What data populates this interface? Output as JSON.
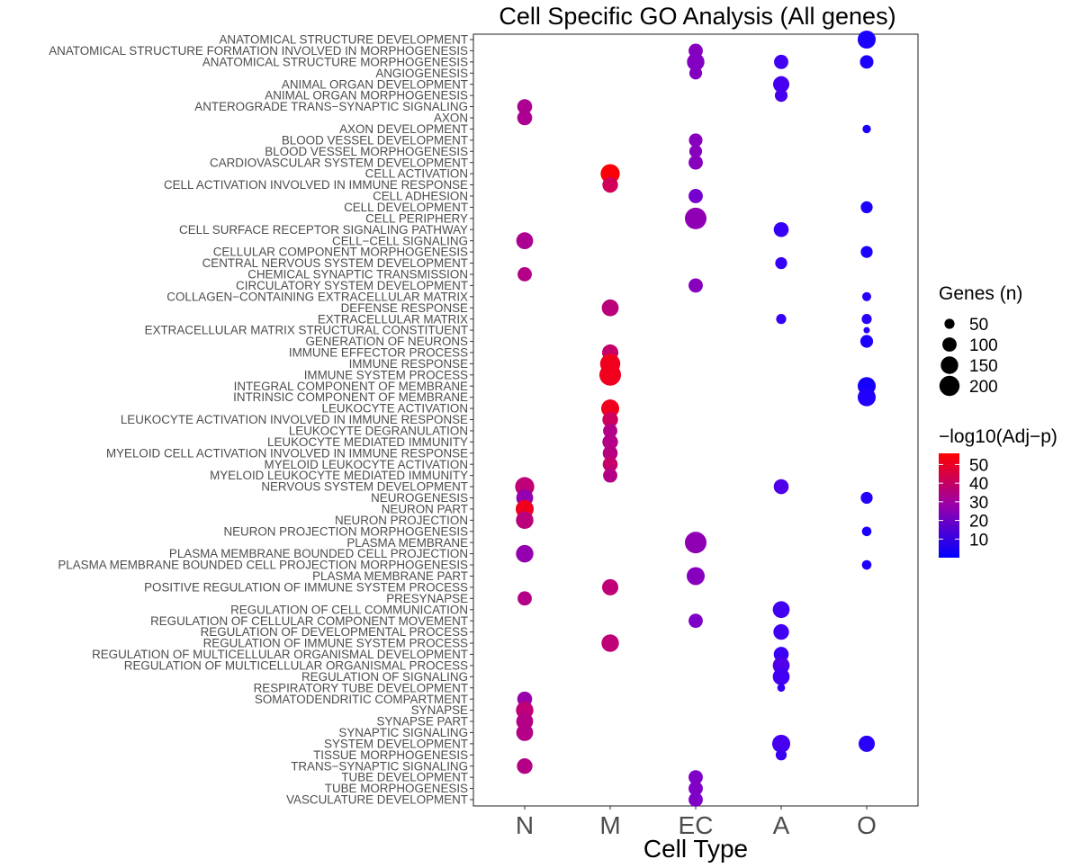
{
  "chart_data": {
    "type": "scatter",
    "subtype": "dot-plot",
    "title": "Cell Specific GO Analysis (All genes)",
    "xlabel": "Cell Type",
    "ylabel": "",
    "x_categories": [
      "N",
      "M",
      "EC",
      "A",
      "O"
    ],
    "y_categories": [
      "ANATOMICAL STRUCTURE DEVELOPMENT",
      "ANATOMICAL STRUCTURE FORMATION INVOLVED IN MORPHOGENESIS",
      "ANATOMICAL STRUCTURE MORPHOGENESIS",
      "ANGIOGENESIS",
      "ANIMAL ORGAN DEVELOPMENT",
      "ANIMAL ORGAN MORPHOGENESIS",
      "ANTEROGRADE TRANS−SYNAPTIC SIGNALING",
      "AXON",
      "AXON DEVELOPMENT",
      "BLOOD VESSEL DEVELOPMENT",
      "BLOOD VESSEL MORPHOGENESIS",
      "CARDIOVASCULAR SYSTEM DEVELOPMENT",
      "CELL ACTIVATION",
      "CELL ACTIVATION INVOLVED IN IMMUNE RESPONSE",
      "CELL ADHESION",
      "CELL DEVELOPMENT",
      "CELL PERIPHERY",
      "CELL SURFACE RECEPTOR SIGNALING PATHWAY",
      "CELL−CELL SIGNALING",
      "CELLULAR COMPONENT MORPHOGENESIS",
      "CENTRAL NERVOUS SYSTEM DEVELOPMENT",
      "CHEMICAL SYNAPTIC TRANSMISSION",
      "CIRCULATORY SYSTEM DEVELOPMENT",
      "COLLAGEN−CONTAINING EXTRACELLULAR MATRIX",
      "DEFENSE RESPONSE",
      "EXTRACELLULAR MATRIX",
      "EXTRACELLULAR MATRIX STRUCTURAL CONSTITUENT",
      "GENERATION OF NEURONS",
      "IMMUNE EFFECTOR PROCESS",
      "IMMUNE RESPONSE",
      "IMMUNE SYSTEM PROCESS",
      "INTEGRAL COMPONENT OF MEMBRANE",
      "INTRINSIC COMPONENT OF MEMBRANE",
      "LEUKOCYTE ACTIVATION",
      "LEUKOCYTE ACTIVATION INVOLVED IN IMMUNE RESPONSE",
      "LEUKOCYTE DEGRANULATION",
      "LEUKOCYTE MEDIATED IMMUNITY",
      "MYELOID CELL ACTIVATION INVOLVED IN IMMUNE RESPONSE",
      "MYELOID LEUKOCYTE ACTIVATION",
      "MYELOID LEUKOCYTE MEDIATED IMMUNITY",
      "NERVOUS SYSTEM DEVELOPMENT",
      "NEUROGENESIS",
      "NEURON PART",
      "NEURON PROJECTION",
      "NEURON PROJECTION MORPHOGENESIS",
      "PLASMA MEMBRANE",
      "PLASMA MEMBRANE BOUNDED CELL PROJECTION",
      "PLASMA MEMBRANE BOUNDED CELL PROJECTION MORPHOGENESIS",
      "PLASMA MEMBRANE PART",
      "POSITIVE REGULATION OF IMMUNE SYSTEM PROCESS",
      "PRESYNAPSE",
      "REGULATION OF CELL COMMUNICATION",
      "REGULATION OF CELLULAR COMPONENT MOVEMENT",
      "REGULATION OF DEVELOPMENTAL PROCESS",
      "REGULATION OF IMMUNE SYSTEM PROCESS",
      "REGULATION OF MULTICELLULAR ORGANISMAL DEVELOPMENT",
      "REGULATION OF MULTICELLULAR ORGANISMAL PROCESS",
      "REGULATION OF SIGNALING",
      "RESPIRATORY TUBE DEVELOPMENT",
      "SOMATODENDRITIC COMPARTMENT",
      "SYNAPSE",
      "SYNAPSE PART",
      "SYNAPTIC SIGNALING",
      "SYSTEM DEVELOPMENT",
      "TISSUE MORPHOGENESIS",
      "TRANS−SYNAPTIC SIGNALING",
      "TUBE DEVELOPMENT",
      "TUBE MORPHOGENESIS",
      "VASCULATURE DEVELOPMENT"
    ],
    "points": [
      {
        "term": "ANATOMICAL STRUCTURE DEVELOPMENT",
        "cell": "O",
        "genes": 160,
        "neglog10p": 3
      },
      {
        "term": "ANATOMICAL STRUCTURE FORMATION INVOLVED IN MORPHOGENESIS",
        "cell": "EC",
        "genes": 100,
        "neglog10p": 24
      },
      {
        "term": "ANATOMICAL STRUCTURE MORPHOGENESIS",
        "cell": "EC",
        "genes": 150,
        "neglog10p": 23
      },
      {
        "term": "ANATOMICAL STRUCTURE MORPHOGENESIS",
        "cell": "A",
        "genes": 100,
        "neglog10p": 9
      },
      {
        "term": "ANATOMICAL STRUCTURE MORPHOGENESIS",
        "cell": "O",
        "genes": 90,
        "neglog10p": 3
      },
      {
        "term": "ANGIOGENESIS",
        "cell": "EC",
        "genes": 80,
        "neglog10p": 23
      },
      {
        "term": "ANIMAL ORGAN DEVELOPMENT",
        "cell": "A",
        "genes": 130,
        "neglog10p": 10
      },
      {
        "term": "ANIMAL ORGAN MORPHOGENESIS",
        "cell": "A",
        "genes": 80,
        "neglog10p": 10
      },
      {
        "term": "ANTEROGRADE TRANS−SYNAPTIC SIGNALING",
        "cell": "N",
        "genes": 110,
        "neglog10p": 33
      },
      {
        "term": "AXON",
        "cell": "N",
        "genes": 110,
        "neglog10p": 33
      },
      {
        "term": "AXON DEVELOPMENT",
        "cell": "O",
        "genes": 35,
        "neglog10p": 3
      },
      {
        "term": "BLOOD VESSEL DEVELOPMENT",
        "cell": "EC",
        "genes": 90,
        "neglog10p": 24
      },
      {
        "term": "BLOOD VESSEL MORPHOGENESIS",
        "cell": "EC",
        "genes": 80,
        "neglog10p": 24
      },
      {
        "term": "CARDIOVASCULAR SYSTEM DEVELOPMENT",
        "cell": "EC",
        "genes": 100,
        "neglog10p": 24
      },
      {
        "term": "CELL ACTIVATION",
        "cell": "M",
        "genes": 180,
        "neglog10p": 55
      },
      {
        "term": "CELL ACTIVATION INVOLVED IN IMMUNE RESPONSE",
        "cell": "M",
        "genes": 120,
        "neglog10p": 43
      },
      {
        "term": "CELL ADHESION",
        "cell": "EC",
        "genes": 100,
        "neglog10p": 20
      },
      {
        "term": "CELL DEVELOPMENT",
        "cell": "O",
        "genes": 70,
        "neglog10p": 3
      },
      {
        "term": "CELL PERIPHERY",
        "cell": "EC",
        "genes": 230,
        "neglog10p": 26
      },
      {
        "term": "CELL SURFACE RECEPTOR SIGNALING PATHWAY",
        "cell": "A",
        "genes": 110,
        "neglog10p": 7
      },
      {
        "term": "CELL−CELL SIGNALING",
        "cell": "N",
        "genes": 140,
        "neglog10p": 33
      },
      {
        "term": "CELLULAR COMPONENT MORPHOGENESIS",
        "cell": "O",
        "genes": 70,
        "neglog10p": 3
      },
      {
        "term": "CENTRAL NERVOUS SYSTEM DEVELOPMENT",
        "cell": "A",
        "genes": 70,
        "neglog10p": 7
      },
      {
        "term": "CHEMICAL SYNAPTIC TRANSMISSION",
        "cell": "N",
        "genes": 100,
        "neglog10p": 35
      },
      {
        "term": "CIRCULATORY SYSTEM DEVELOPMENT",
        "cell": "EC",
        "genes": 100,
        "neglog10p": 24
      },
      {
        "term": "COLLAGEN−CONTAINING EXTRACELLULAR MATRIX",
        "cell": "O",
        "genes": 40,
        "neglog10p": 5
      },
      {
        "term": "DEFENSE RESPONSE",
        "cell": "M",
        "genes": 140,
        "neglog10p": 37
      },
      {
        "term": "EXTRACELLULAR MATRIX",
        "cell": "A",
        "genes": 50,
        "neglog10p": 7
      },
      {
        "term": "EXTRACELLULAR MATRIX",
        "cell": "O",
        "genes": 50,
        "neglog10p": 5
      },
      {
        "term": "EXTRACELLULAR MATRIX STRUCTURAL CONSTITUENT",
        "cell": "O",
        "genes": 20,
        "neglog10p": 5
      },
      {
        "term": "GENERATION OF NEURONS",
        "cell": "O",
        "genes": 80,
        "neglog10p": 3
      },
      {
        "term": "IMMUNE EFFECTOR PROCESS",
        "cell": "M",
        "genes": 130,
        "neglog10p": 40
      },
      {
        "term": "IMMUNE RESPONSE",
        "cell": "M",
        "genes": 200,
        "neglog10p": 52
      },
      {
        "term": "IMMUNE SYSTEM PROCESS",
        "cell": "M",
        "genes": 230,
        "neglog10p": 52
      },
      {
        "term": "INTEGRAL COMPONENT OF MEMBRANE",
        "cell": "O",
        "genes": 160,
        "neglog10p": 2
      },
      {
        "term": "INTRINSIC COMPONENT OF MEMBRANE",
        "cell": "O",
        "genes": 160,
        "neglog10p": 4
      },
      {
        "term": "LEUKOCYTE ACTIVATION",
        "cell": "M",
        "genes": 160,
        "neglog10p": 52
      },
      {
        "term": "LEUKOCYTE ACTIVATION INVOLVED IN IMMUNE RESPONSE",
        "cell": "M",
        "genes": 120,
        "neglog10p": 42
      },
      {
        "term": "LEUKOCYTE DEGRANULATION",
        "cell": "M",
        "genes": 100,
        "neglog10p": 35
      },
      {
        "term": "LEUKOCYTE MEDIATED IMMUNITY",
        "cell": "M",
        "genes": 120,
        "neglog10p": 35
      },
      {
        "term": "MYELOID CELL ACTIVATION INVOLVED IN IMMUNE RESPONSE",
        "cell": "M",
        "genes": 110,
        "neglog10p": 36
      },
      {
        "term": "MYELOID LEUKOCYTE ACTIVATION",
        "cell": "M",
        "genes": 110,
        "neglog10p": 40
      },
      {
        "term": "MYELOID LEUKOCYTE MEDIATED IMMUNITY",
        "cell": "M",
        "genes": 100,
        "neglog10p": 35
      },
      {
        "term": "NERVOUS SYSTEM DEVELOPMENT",
        "cell": "N",
        "genes": 180,
        "neglog10p": 38
      },
      {
        "term": "NERVOUS SYSTEM DEVELOPMENT",
        "cell": "A",
        "genes": 110,
        "neglog10p": 12
      },
      {
        "term": "NEUROGENESIS",
        "cell": "N",
        "genes": 140,
        "neglog10p": 27
      },
      {
        "term": "NEUROGENESIS",
        "cell": "O",
        "genes": 70,
        "neglog10p": 4
      },
      {
        "term": "NEURON PART",
        "cell": "N",
        "genes": 160,
        "neglog10p": 52
      },
      {
        "term": "NEURON PROJECTION",
        "cell": "N",
        "genes": 150,
        "neglog10p": 37
      },
      {
        "term": "NEURON PROJECTION MORPHOGENESIS",
        "cell": "O",
        "genes": 45,
        "neglog10p": 3
      },
      {
        "term": "PLASMA MEMBRANE",
        "cell": "EC",
        "genes": 230,
        "neglog10p": 26
      },
      {
        "term": "PLASMA MEMBRANE BOUNDED CELL PROJECTION",
        "cell": "N",
        "genes": 150,
        "neglog10p": 27
      },
      {
        "term": "PLASMA MEMBRANE BOUNDED CELL PROJECTION MORPHOGENESIS",
        "cell": "O",
        "genes": 45,
        "neglog10p": 3
      },
      {
        "term": "PLASMA MEMBRANE PART",
        "cell": "EC",
        "genes": 160,
        "neglog10p": 24
      },
      {
        "term": "POSITIVE REGULATION OF IMMUNE SYSTEM PROCESS",
        "cell": "M",
        "genes": 130,
        "neglog10p": 38
      },
      {
        "term": "PRESYNAPSE",
        "cell": "N",
        "genes": 100,
        "neglog10p": 35
      },
      {
        "term": "REGULATION OF CELL COMMUNICATION",
        "cell": "A",
        "genes": 140,
        "neglog10p": 9
      },
      {
        "term": "REGULATION OF CELLULAR COMPONENT MOVEMENT",
        "cell": "EC",
        "genes": 100,
        "neglog10p": 22
      },
      {
        "term": "REGULATION OF DEVELOPMENTAL PROCESS",
        "cell": "A",
        "genes": 120,
        "neglog10p": 9
      },
      {
        "term": "REGULATION OF IMMUNE SYSTEM PROCESS",
        "cell": "M",
        "genes": 150,
        "neglog10p": 38
      },
      {
        "term": "REGULATION OF MULTICELLULAR ORGANISMAL DEVELOPMENT",
        "cell": "A",
        "genes": 110,
        "neglog10p": 8
      },
      {
        "term": "REGULATION OF MULTICELLULAR ORGANISMAL PROCESS",
        "cell": "A",
        "genes": 140,
        "neglog10p": 12
      },
      {
        "term": "REGULATION OF SIGNALING",
        "cell": "A",
        "genes": 140,
        "neglog10p": 9
      },
      {
        "term": "RESPIRATORY TUBE DEVELOPMENT",
        "cell": "A",
        "genes": 30,
        "neglog10p": 7
      },
      {
        "term": "SOMATODENDRITIC COMPARTMENT",
        "cell": "N",
        "genes": 110,
        "neglog10p": 28
      },
      {
        "term": "SYNAPSE",
        "cell": "N",
        "genes": 150,
        "neglog10p": 38
      },
      {
        "term": "SYNAPSE PART",
        "cell": "N",
        "genes": 140,
        "neglog10p": 35
      },
      {
        "term": "SYNAPTIC SIGNALING",
        "cell": "N",
        "genes": 140,
        "neglog10p": 35
      },
      {
        "term": "SYSTEM DEVELOPMENT",
        "cell": "A",
        "genes": 160,
        "neglog10p": 10
      },
      {
        "term": "SYSTEM DEVELOPMENT",
        "cell": "O",
        "genes": 130,
        "neglog10p": 5
      },
      {
        "term": "TISSUE MORPHOGENESIS",
        "cell": "A",
        "genes": 60,
        "neglog10p": 8
      },
      {
        "term": "TRANS−SYNAPTIC SIGNALING",
        "cell": "N",
        "genes": 120,
        "neglog10p": 35
      },
      {
        "term": "TUBE DEVELOPMENT",
        "cell": "EC",
        "genes": 100,
        "neglog10p": 22
      },
      {
        "term": "TUBE MORPHOGENESIS",
        "cell": "EC",
        "genes": 100,
        "neglog10p": 22
      },
      {
        "term": "VASCULATURE DEVELOPMENT",
        "cell": "EC",
        "genes": 100,
        "neglog10p": 22
      }
    ],
    "size_legend": {
      "title": "Genes (n)",
      "breaks": [
        50,
        100,
        150,
        200
      ],
      "labels": [
        "50",
        "100",
        "150",
        "200"
      ]
    },
    "color_legend": {
      "title": "−log10(Adj−p)",
      "low_color": "#0000FF",
      "high_color": "#FF0000",
      "range": [
        0,
        56
      ],
      "breaks": [
        10,
        20,
        30,
        40,
        50
      ],
      "labels": [
        "10",
        "20",
        "30",
        "40",
        "50"
      ]
    },
    "legend_position": "right",
    "grid": false
  }
}
